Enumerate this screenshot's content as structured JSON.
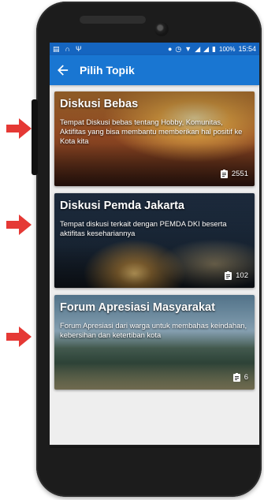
{
  "statusbar": {
    "time": "15:54",
    "battery": "100%",
    "left_icons": [
      "message-icon",
      "headset-icon",
      "usb-icon"
    ],
    "right_icons": [
      "location-icon",
      "alarm-icon",
      "wifi-icon",
      "signal-icon",
      "signal-icon",
      "battery-icon"
    ]
  },
  "appbar": {
    "title": "Pilih Topik"
  },
  "topics": [
    {
      "title": "Diskusi Bebas",
      "description": "Tempat Diskusi bebas tentang Hobby, Komunitas, Aktifitas yang bisa membantu memberikan hal positif ke Kota kita",
      "count": "2551"
    },
    {
      "title": "Diskusi Pemda Jakarta",
      "description": "Tempat diskusi terkait dengan PEMDA DKI beserta aktifitas kesehariannya",
      "count": "102"
    },
    {
      "title": "Forum Apresiasi Masyarakat",
      "description": "Forum Apresiasi dari warga untuk membahas keindahan, kebersihan dan ketertiban kota",
      "count": "6"
    }
  ],
  "colors": {
    "appbar": "#1976d2",
    "statusbar": "#1565c0",
    "pointer_arrow": "#e53935"
  }
}
